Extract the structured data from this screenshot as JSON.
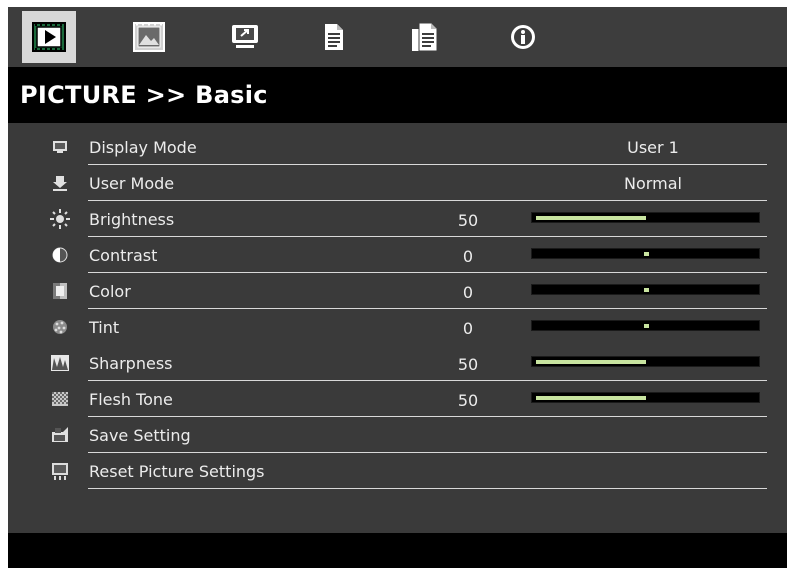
{
  "tabs": [
    {
      "id": "picture",
      "icon": "picture-icon",
      "active": true
    },
    {
      "id": "display",
      "icon": "display-icon",
      "active": false
    },
    {
      "id": "setup",
      "icon": "setup-icon",
      "active": false
    },
    {
      "id": "options",
      "icon": "document-icon",
      "active": false
    },
    {
      "id": "options-advanced",
      "icon": "documents-icon",
      "active": false
    },
    {
      "id": "info",
      "icon": "info-icon",
      "active": false
    }
  ],
  "header": {
    "title": "PICTURE >> Basic"
  },
  "menu": {
    "items": [
      {
        "label": "Display Mode",
        "icon": "display-mode-icon",
        "setting": "User 1"
      },
      {
        "label": "User Mode",
        "icon": "user-mode-icon",
        "setting": "Normal"
      },
      {
        "label": "Brightness",
        "icon": "brightness-icon",
        "value": "50",
        "level": 0.5
      },
      {
        "label": "Contrast",
        "icon": "contrast-icon",
        "value": "0",
        "level": 0.5
      },
      {
        "label": "Color",
        "icon": "color-icon",
        "value": "0",
        "level": 0.5
      },
      {
        "label": "Tint",
        "icon": "tint-icon",
        "value": "0",
        "level": 0.5
      },
      {
        "label": "Sharpness",
        "icon": "sharpness-icon",
        "value": "50",
        "level": 0.5
      },
      {
        "label": "Flesh Tone",
        "icon": "flesh-tone-icon",
        "value": "50",
        "level": 0.5
      },
      {
        "label": "Save Setting",
        "icon": "save-setting-icon"
      },
      {
        "label": "Reset Picture Settings",
        "icon": "reset-icon"
      }
    ]
  },
  "colors": {
    "accent": "#c8e4a0",
    "menu_bg": "#3a3a3a",
    "title_bg": "#000000",
    "text": "#ececec"
  }
}
